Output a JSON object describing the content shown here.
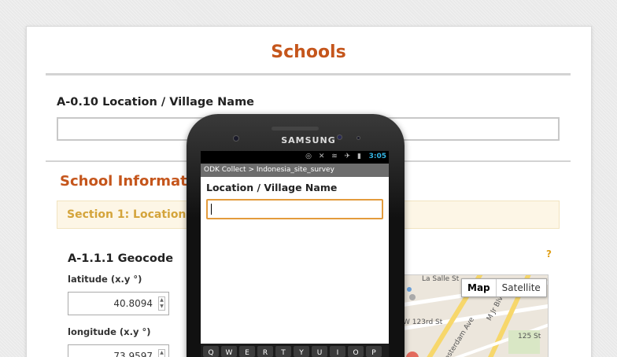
{
  "form": {
    "title": "Schools",
    "question": "A-0.10 Location / Village Name",
    "group_title": "School Information",
    "section_title": "Section 1: Location and",
    "geocode_label": "A-1.1.1 Geocode",
    "help_mark": "?",
    "latitude_label": "latitude (x.y °)",
    "latitude_value": "40.8094",
    "longitude_label": "longitude (x.y °)",
    "longitude_value": "73.9597",
    "map_buttons": {
      "map": "Map",
      "satellite": "Satellite"
    },
    "map_labels": [
      "La Salle St",
      "W 123rd St",
      "Amsterdam Ave",
      "M Jr Blvd",
      "125 St"
    ]
  },
  "phone": {
    "brand": "SAMSUNG",
    "time": "3:05",
    "status_icons": "◎ ✕ ≋ ✈ ▮",
    "app_bar": "ODK Collect > Indonesia_site_survey",
    "question": "Location / Village Name",
    "input_value": "",
    "keys": [
      "Q",
      "W",
      "E",
      "R",
      "T",
      "Y",
      "U",
      "I",
      "O",
      "P"
    ]
  }
}
